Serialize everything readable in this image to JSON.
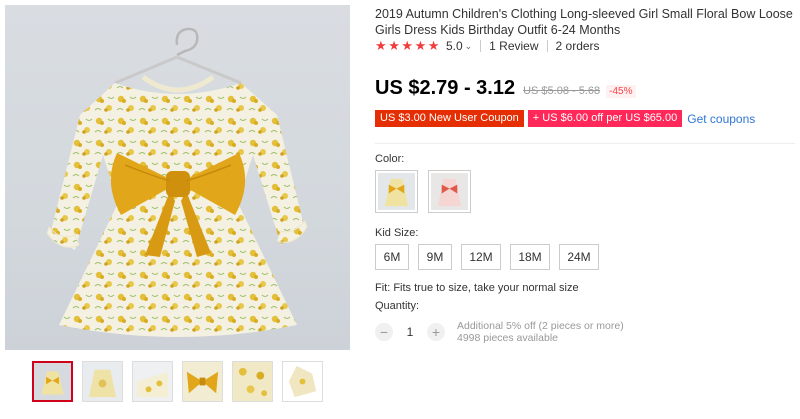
{
  "product": {
    "title": "2019 Autumn Children's Clothing Long-sleeved Girl Small Floral Bow Loose Girls Dress Kids Birthday Outfit 6-24 Months",
    "rating": "5.0",
    "star_count": 5,
    "reviews": "1 Review",
    "orders": "2 orders"
  },
  "price": {
    "current": "US $2.79 - 3.12",
    "original": "US $5.08 - 5.68",
    "discount": "-45%"
  },
  "coupons": {
    "new_user": "US $3.00 New User Coupon",
    "store": "+ US $6.00 off per US $65.00",
    "get_link": "Get coupons"
  },
  "color": {
    "label": "Color:",
    "options": [
      "yellow-floral",
      "pink-floral"
    ]
  },
  "size": {
    "label": "Kid Size:",
    "options": [
      "6M",
      "9M",
      "12M",
      "18M",
      "24M"
    ]
  },
  "fit": "Fit: Fits true to size, take your normal size",
  "quantity": {
    "label": "Quantity:",
    "value": "1",
    "minus": "−",
    "plus": "+",
    "note_line1": "Additional 5% off (2 pieces or more)",
    "note_line2": "4998 pieces available"
  },
  "colors": {
    "star": "#f23c3c",
    "price": "#000000",
    "coupon_red": "#e62e04",
    "coupon_pink": "#ff2858",
    "link_blue": "#2f76d3",
    "active_thumb": "#d0021b",
    "dress_yellow": "#e8c53a",
    "bow": "#e2a61a"
  },
  "gallery": {
    "thumbnail_count": 6,
    "active_index": 0
  }
}
